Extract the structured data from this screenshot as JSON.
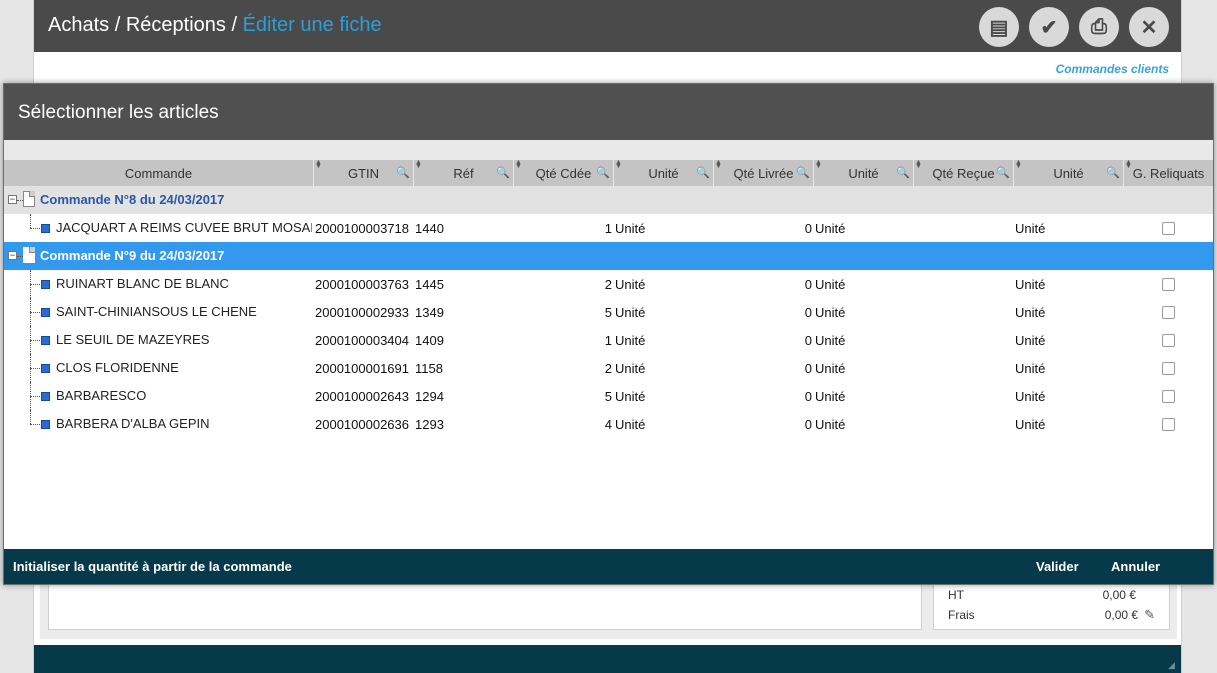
{
  "app": {
    "breadcrumb": [
      "Achats",
      "Réceptions"
    ],
    "breadcrumb_sep": "/",
    "current": "Éditer une fiche",
    "link_commandes": "Commandes clients",
    "toolbar": [
      {
        "name": "save-icon",
        "glyph": "▤"
      },
      {
        "name": "validate-icon",
        "glyph": "✔"
      },
      {
        "name": "print-icon",
        "glyph": "⎙"
      },
      {
        "name": "close-icon",
        "glyph": "✕"
      }
    ],
    "totals": {
      "ht_label": "HT",
      "ht_value": "0,00 €",
      "frais_label": "Frais",
      "frais_value": "0,00 €"
    }
  },
  "modal": {
    "title": "Sélectionner les articles",
    "columns": [
      "Commande",
      "GTIN",
      "Réf",
      "Qté Cdée",
      "Unité",
      "Qté Livrée",
      "Unité",
      "Qté Reçue",
      "Unité",
      "G. Reliquats"
    ],
    "groups": [
      {
        "title": "Commande N°8 du 24/03/2017",
        "selected": false,
        "items": [
          {
            "name": "JACQUART A REIMS CUVEE BRUT  MOSAIQUE",
            "gtin": "2000100003718",
            "ref": "1440",
            "qte_cdee": "1",
            "unite1": "Unité",
            "qte_livree": "0",
            "unite2": "Unité",
            "qte_recue": "",
            "unite3": "Unité"
          }
        ]
      },
      {
        "title": "Commande N°9 du 24/03/2017",
        "selected": true,
        "items": [
          {
            "name": "RUINART BLANC DE BLANC",
            "gtin": "2000100003763",
            "ref": "1445",
            "qte_cdee": "2",
            "unite1": "Unité",
            "qte_livree": "0",
            "unite2": "Unité",
            "qte_recue": "",
            "unite3": "Unité"
          },
          {
            "name": "SAINT-CHINIANSOUS LE CHENE",
            "gtin": "2000100002933",
            "ref": "1349",
            "qte_cdee": "5",
            "unite1": "Unité",
            "qte_livree": "0",
            "unite2": "Unité",
            "qte_recue": "",
            "unite3": "Unité"
          },
          {
            "name": "LE SEUIL DE MAZEYRES",
            "gtin": "2000100003404",
            "ref": "1409",
            "qte_cdee": "1",
            "unite1": "Unité",
            "qte_livree": "0",
            "unite2": "Unité",
            "qte_recue": "",
            "unite3": "Unité"
          },
          {
            "name": "CLOS FLORIDENNE",
            "gtin": "2000100001691",
            "ref": "1158",
            "qte_cdee": "2",
            "unite1": "Unité",
            "qte_livree": "0",
            "unite2": "Unité",
            "qte_recue": "",
            "unite3": "Unité"
          },
          {
            "name": "BARBARESCO",
            "gtin": "2000100002643",
            "ref": "1294",
            "qte_cdee": "5",
            "unite1": "Unité",
            "qte_livree": "0",
            "unite2": "Unité",
            "qte_recue": "",
            "unite3": "Unité"
          },
          {
            "name": "BARBERA D'ALBA  GEPIN",
            "gtin": "2000100002636",
            "ref": "1293",
            "qte_cdee": "4",
            "unite1": "Unité",
            "qte_livree": "0",
            "unite2": "Unité",
            "qte_recue": "",
            "unite3": "Unité"
          }
        ]
      }
    ],
    "footer": {
      "init_label": "Initialiser la quantité à partir de la commande",
      "valider": "Valider",
      "annuler": "Annuler"
    }
  }
}
